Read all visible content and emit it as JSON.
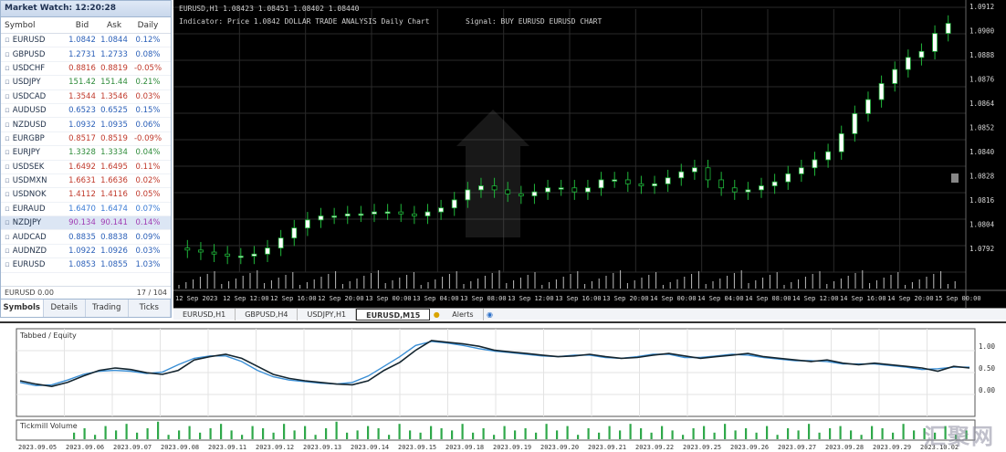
{
  "market_watch": {
    "title": "Market Watch: 12:20:28",
    "columns": {
      "symbol": "Symbol",
      "bid": "Bid",
      "ask": "Ask",
      "daily": "Daily"
    },
    "rows": [
      {
        "symbol": "EURUSD",
        "bid": "1.0842",
        "ask": "1.0844",
        "daily": "0.12%",
        "color": "#2a5fb8"
      },
      {
        "symbol": "GBPUSD",
        "bid": "1.2731",
        "ask": "1.2733",
        "daily": "0.08%",
        "color": "#2a5fb8"
      },
      {
        "symbol": "USDCHF",
        "bid": "0.8816",
        "ask": "0.8819",
        "daily": "-0.05%",
        "color": "#c0392b"
      },
      {
        "symbol": "USDJPY",
        "bid": "151.42",
        "ask": "151.44",
        "daily": "0.21%",
        "color": "#2e8b3a"
      },
      {
        "symbol": "USDCAD",
        "bid": "1.3544",
        "ask": "1.3546",
        "daily": "0.03%",
        "color": "#c0392b"
      },
      {
        "symbol": "AUDUSD",
        "bid": "0.6523",
        "ask": "0.6525",
        "daily": "0.15%",
        "color": "#2a5fb8"
      },
      {
        "symbol": "NZDUSD",
        "bid": "1.0932",
        "ask": "1.0935",
        "daily": "0.06%",
        "color": "#2a5fb8"
      },
      {
        "symbol": "EURGBP",
        "bid": "0.8517",
        "ask": "0.8519",
        "daily": "-0.09%",
        "color": "#c0392b"
      },
      {
        "symbol": "EURJPY",
        "bid": "1.3328",
        "ask": "1.3334",
        "daily": "0.04%",
        "color": "#2e8b3a"
      },
      {
        "symbol": "USDSEK",
        "bid": "1.6492",
        "ask": "1.6495",
        "daily": "0.11%",
        "color": "#c0392b"
      },
      {
        "symbol": "USDMXN",
        "bid": "1.6631",
        "ask": "1.6636",
        "daily": "0.02%",
        "color": "#c0392b"
      },
      {
        "symbol": "USDNOK",
        "bid": "1.4112",
        "ask": "1.4116",
        "daily": "0.05%",
        "color": "#c0392b"
      },
      {
        "symbol": "EURAUD",
        "bid": "1.6470",
        "ask": "1.6474",
        "daily": "0.07%",
        "color": "#3a7bd5"
      },
      {
        "symbol": "NZDJPY",
        "bid": "90.134",
        "ask": "90.141",
        "daily": "0.14%",
        "color": "#a03cb3"
      },
      {
        "symbol": "AUDCAD",
        "bid": "0.8835",
        "ask": "0.8838",
        "daily": "0.09%",
        "color": "#2a5fb8"
      },
      {
        "symbol": "AUDNZD",
        "bid": "1.0922",
        "ask": "1.0926",
        "daily": "0.03%",
        "color": "#2a5fb8"
      },
      {
        "symbol": "EURUSD",
        "bid": "1.0853",
        "ask": "1.0855",
        "daily": "1.03%",
        "color": "#2a5fb8"
      }
    ],
    "status_left": "EURUSD 0.00",
    "status_right": "17 / 104",
    "tabs": [
      "Symbols",
      "Details",
      "Trading",
      "Ticks"
    ]
  },
  "chart": {
    "header_line1": "EURUSD,H1 1.08423 1.08451 1.08402 1.08440",
    "header_line2": "Indicator: Price 1.0842 DOLLAR TRADE ANALYSIS  Daily Chart",
    "header_right": "Signal: BUY  EURUSD  EURUSD CHART",
    "price_labels": [
      "1.0912",
      "1.0900",
      "1.0888",
      "1.0876",
      "1.0864",
      "1.0852",
      "1.0840",
      "1.0828",
      "1.0816",
      "1.0804",
      "1.0792"
    ],
    "time_labels": [
      "12 Sep 2023",
      "12 Sep 12:00",
      "12 Sep 16:00",
      "12 Sep 20:00",
      "13 Sep 00:00",
      "13 Sep 04:00",
      "13 Sep 08:00",
      "13 Sep 12:00",
      "13 Sep 16:00",
      "13 Sep 20:00",
      "14 Sep 00:00",
      "14 Sep 04:00",
      "14 Sep 08:00",
      "14 Sep 12:00",
      "14 Sep 16:00",
      "14 Sep 20:00",
      "15 Sep 00:00"
    ],
    "tabs": [
      "EURUSD,H1",
      "GBPUSD,H4",
      "USDJPY,H1",
      "EURUSD,M15"
    ],
    "active_tab": 3
  },
  "chart_data": {
    "type": "candlestick",
    "bull_color": "#ffffff",
    "bear_color": "#000000",
    "wick_color": "#1fb53a",
    "open": [
      1.0798,
      1.0797,
      1.0796,
      1.0795,
      1.0794,
      1.0794,
      1.0795,
      1.0798,
      1.0803,
      1.0808,
      1.0812,
      1.0814,
      1.0814,
      1.0815,
      1.0815,
      1.0816,
      1.0816,
      1.0815,
      1.0814,
      1.0816,
      1.0818,
      1.0822,
      1.0827,
      1.0829,
      1.0827,
      1.0825,
      1.0824,
      1.0826,
      1.0828,
      1.0828,
      1.0826,
      1.0828,
      1.0832,
      1.0832,
      1.083,
      1.0829,
      1.083,
      1.0833,
      1.0836,
      1.0838,
      1.0832,
      1.0828,
      1.0826,
      1.0827,
      1.0829,
      1.0831,
      1.0835,
      1.0838,
      1.0842,
      1.0846,
      1.0855,
      1.0865,
      1.0872,
      1.088,
      1.0887,
      1.0893,
      1.0896,
      1.0905
    ],
    "close": [
      1.0797,
      1.0796,
      1.0795,
      1.0794,
      1.0794,
      1.0795,
      1.0798,
      1.0803,
      1.0808,
      1.0812,
      1.0814,
      1.0814,
      1.0815,
      1.0815,
      1.0816,
      1.0816,
      1.0815,
      1.0814,
      1.0816,
      1.0818,
      1.0822,
      1.0827,
      1.0829,
      1.0827,
      1.0825,
      1.0824,
      1.0826,
      1.0828,
      1.0828,
      1.0826,
      1.0828,
      1.0832,
      1.0832,
      1.083,
      1.0829,
      1.083,
      1.0833,
      1.0836,
      1.0838,
      1.0832,
      1.0828,
      1.0826,
      1.0827,
      1.0829,
      1.0831,
      1.0835,
      1.0838,
      1.0842,
      1.0846,
      1.0855,
      1.0865,
      1.0872,
      1.088,
      1.0887,
      1.0893,
      1.0896,
      1.0905,
      1.091
    ],
    "ylim": [
      1.0786,
      1.0918
    ]
  },
  "bottom": {
    "title": "Tabbed / Equity",
    "volume_title": "Tickmill Volume",
    "right_labels": [
      "1.00",
      "0.50",
      "0.00"
    ],
    "time_labels": [
      "2023.09.05",
      "2023.09.06",
      "2023.09.07",
      "2023.09.08",
      "2023.09.11",
      "2023.09.12",
      "2023.09.13",
      "2023.09.14",
      "2023.09.15",
      "2023.09.18",
      "2023.09.19",
      "2023.09.20",
      "2023.09.21",
      "2023.09.22",
      "2023.09.25",
      "2023.09.26",
      "2023.09.27",
      "2023.09.28",
      "2023.09.29",
      "2023.10.02"
    ],
    "watermark": "汇聚网",
    "series_main": [
      0.42,
      0.38,
      0.35,
      0.4,
      0.48,
      0.55,
      0.58,
      0.56,
      0.52,
      0.5,
      0.55,
      0.68,
      0.72,
      0.75,
      0.7,
      0.6,
      0.5,
      0.45,
      0.42,
      0.4,
      0.38,
      0.37,
      0.42,
      0.55,
      0.65,
      0.8,
      0.92,
      0.9,
      0.88,
      0.85,
      0.8,
      0.78,
      0.76,
      0.74,
      0.72,
      0.73,
      0.75,
      0.72,
      0.7,
      0.71,
      0.74,
      0.76,
      0.73,
      0.7,
      0.72,
      0.74,
      0.76,
      0.72,
      0.7,
      0.68,
      0.66,
      0.68,
      0.64,
      0.62,
      0.64,
      0.62,
      0.6,
      0.58,
      0.54,
      0.6,
      0.58
    ],
    "series_signal": [
      0.4,
      0.36,
      0.37,
      0.43,
      0.5,
      0.54,
      0.55,
      0.54,
      0.51,
      0.53,
      0.62,
      0.7,
      0.73,
      0.73,
      0.66,
      0.55,
      0.47,
      0.43,
      0.41,
      0.39,
      0.38,
      0.4,
      0.48,
      0.6,
      0.72,
      0.86,
      0.91,
      0.89,
      0.86,
      0.82,
      0.79,
      0.77,
      0.75,
      0.73,
      0.72,
      0.74,
      0.74,
      0.71,
      0.7,
      0.72,
      0.75,
      0.75,
      0.71,
      0.71,
      0.73,
      0.75,
      0.74,
      0.71,
      0.69,
      0.67,
      0.67,
      0.66,
      0.63,
      0.63,
      0.63,
      0.61,
      0.59,
      0.56,
      0.57,
      0.59,
      0.59
    ],
    "volumes": [
      3,
      5,
      2,
      6,
      4,
      7,
      3,
      5,
      8,
      2,
      4,
      6,
      3,
      5,
      7,
      4,
      2,
      6,
      5,
      3,
      7,
      4,
      6,
      2,
      5,
      8,
      3,
      4,
      6,
      5,
      2,
      7,
      4,
      3,
      6,
      5,
      4,
      7,
      3,
      5,
      2,
      6,
      4,
      5,
      3,
      7,
      4,
      6,
      2,
      5,
      3,
      6,
      4,
      7,
      5,
      3,
      6,
      4,
      2,
      5,
      6,
      3,
      7,
      4,
      5,
      3,
      6,
      2,
      5,
      4,
      7,
      3,
      5,
      6,
      4,
      2,
      6,
      5,
      3,
      7,
      4,
      5,
      3,
      6,
      2,
      4
    ]
  }
}
